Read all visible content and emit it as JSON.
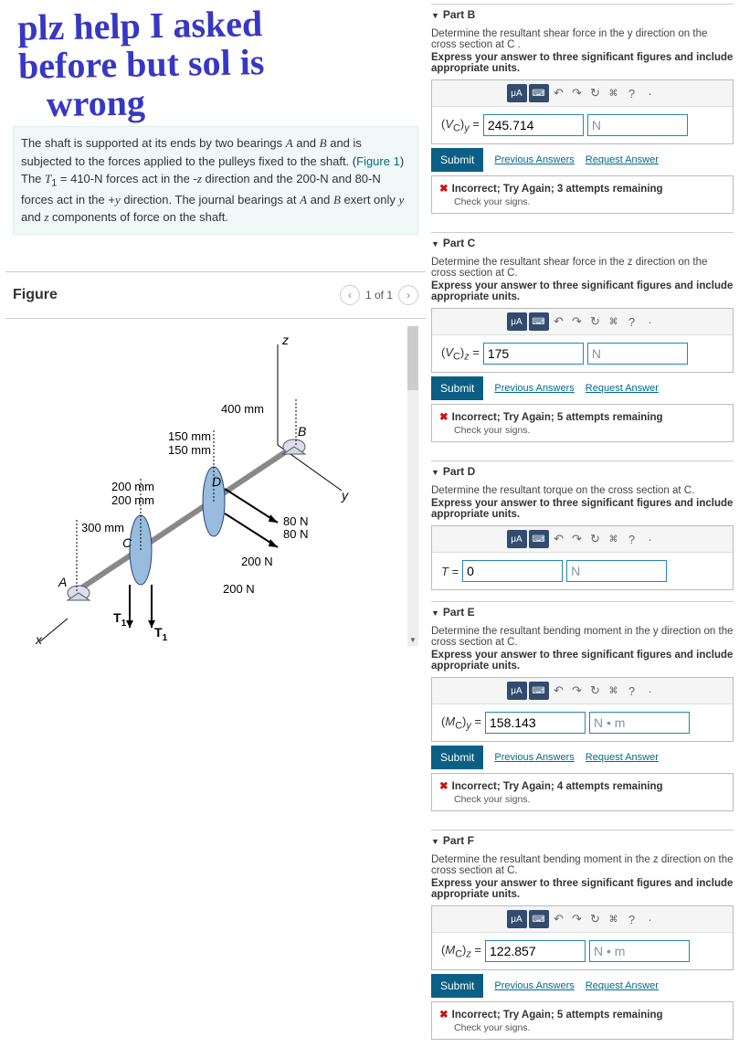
{
  "handwriting": {
    "l1": "plz help I asked",
    "l2": "before but sol is",
    "l3": "wrong"
  },
  "problem": {
    "p1a": "The shaft is supported at its ends by two bearings ",
    "A": "A",
    "p1b": " and ",
    "B": "B",
    "p1c": " and is subjected to the forces applied to the pulleys fixed to the shaft. (",
    "fig": "Figure 1",
    "p1d": ")",
    "p2a": "The ",
    "t1": "T",
    "t1s": "1",
    "eq": " = 410-N",
    "p2b": " forces act in the -",
    "z": "z",
    "p2c": " direction and the 200-N and 80-N forces act in the +",
    "y": "y",
    "p2d": " direction. The journal bearings at ",
    "p2e": " exert only ",
    "p2f": " and ",
    "p2g": " components of force on the shaft."
  },
  "figure": {
    "title": "Figure",
    "page": "1 of 1",
    "labels": {
      "z": "z",
      "y": "y",
      "x": "x",
      "A": "A",
      "B": "B",
      "C": "C",
      "D": "D",
      "m300": "300 mm",
      "m200": "200 mm",
      "m150": "150 mm",
      "m400": "400 mm",
      "n80": "80 N",
      "n200": "200 N",
      "T1": "T",
      "T1s": "1"
    }
  },
  "ui": {
    "submit": "Submit",
    "prev": "Previous Answers",
    "req": "Request Answer"
  },
  "B": {
    "title": "Part B",
    "desc": "Determine the resultant shear force in the y direction on the cross section at C .",
    "bold": "Express your answer to three significant figures and include appropriate units.",
    "var": "(V_C)_y =",
    "val": "245.714",
    "unit": "N",
    "fb": "Incorrect; Try Again; 3 attempts remaining",
    "fbsub": "Check your signs."
  },
  "C": {
    "title": "Part C",
    "desc": "Determine the resultant shear force in the z direction on the cross section at C.",
    "bold": "Express your answer to three significant figures and include appropriate units.",
    "var": "(V_C)_z =",
    "val": "175",
    "unit": "N",
    "fb": "Incorrect; Try Again; 5 attempts remaining",
    "fbsub": "Check your signs."
  },
  "D": {
    "title": "Part D",
    "desc": "Determine the resultant torque on the cross section at C.",
    "bold": "Express your answer to three significant figures and include appropriate units.",
    "var": "T =",
    "val": "0",
    "unit": "N"
  },
  "E": {
    "title": "Part E",
    "desc": "Determine the resultant bending moment in the y direction on the cross section at C.",
    "bold": "Express your answer to three significant figures and include appropriate units.",
    "var": "(M_C)_y =",
    "val": "158.143",
    "unit": "N • m",
    "fb": "Incorrect; Try Again; 4 attempts remaining",
    "fbsub": "Check your signs."
  },
  "F": {
    "title": "Part F",
    "desc": "Determine the resultant bending moment in the z direction on the cross section at C.",
    "bold": "Express your answer to three significant figures and include appropriate units.",
    "var": "(M_C)_z =",
    "val": "122.857",
    "unit": "N • m",
    "fb": "Incorrect; Try Again; 5 attempts remaining",
    "fbsub": "Check your signs."
  }
}
